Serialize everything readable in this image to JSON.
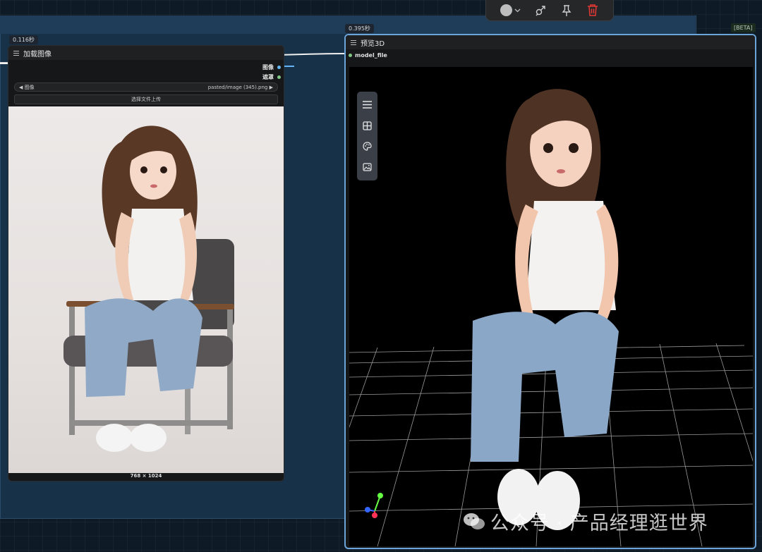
{
  "canvas": {
    "beta_badge": "[BETA]"
  },
  "toolbar": {
    "icons": [
      "color-circle-icon",
      "chevron-down-icon",
      "bypass-icon",
      "pin-icon",
      "trash-icon"
    ]
  },
  "load_image_node": {
    "timing": "0.116秒",
    "title": "加载图像",
    "outputs": [
      {
        "label": "图像",
        "color": "#64b5f6"
      },
      {
        "label": "遮罩",
        "color": "#81c784"
      }
    ],
    "widget": {
      "name": "图像",
      "value": "pasted/image (345).png"
    },
    "upload_label": "选择文件上传",
    "image_size": "768 × 1024"
  },
  "preview_node": {
    "timing": "0.395秒",
    "title": "预览3D",
    "input_label": "model_file",
    "viewport_tools": [
      "menu-icon",
      "grid-layout-icon",
      "palette-icon",
      "image-icon"
    ]
  },
  "watermark": {
    "text": "公众号 · 产品经理逛世界"
  },
  "colors": {
    "accent_border": "#6aa4d8",
    "delete_red": "#e53935"
  }
}
